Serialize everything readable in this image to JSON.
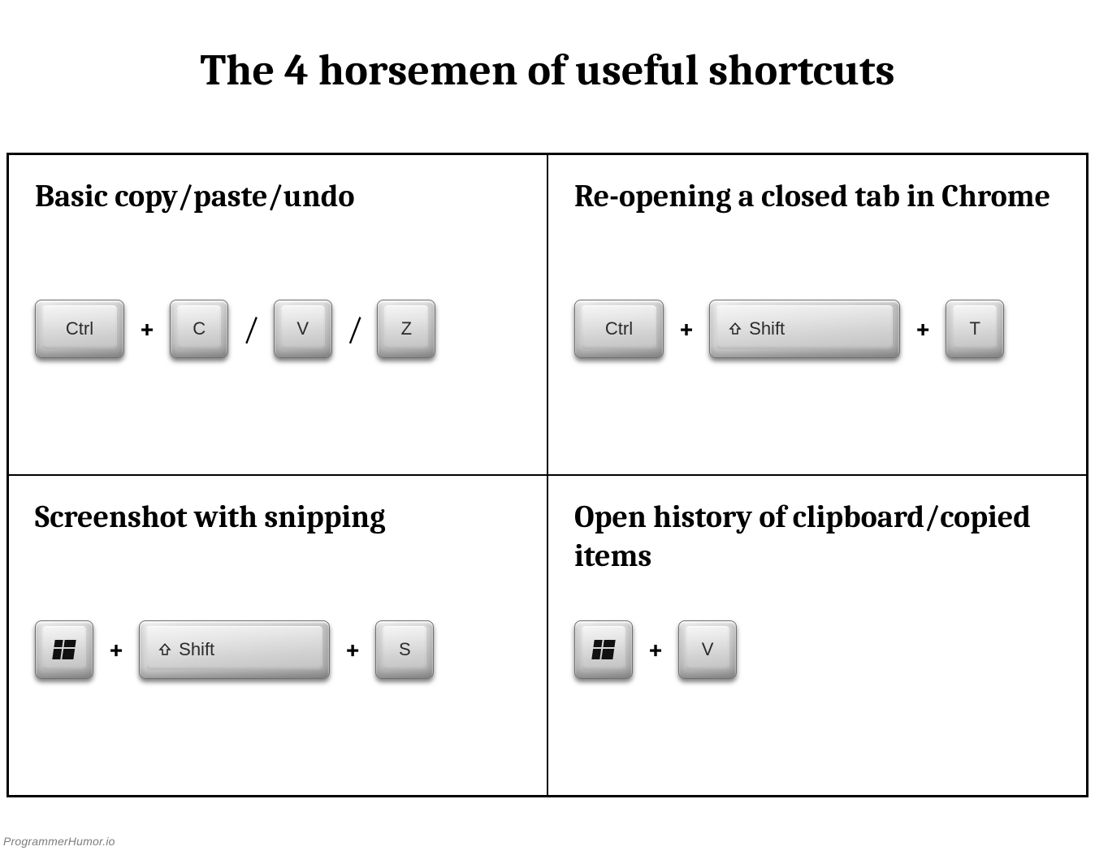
{
  "title": "The 4 horsemen of useful shortcuts",
  "watermark": "ProgrammerHumor.io",
  "sep": {
    "plus": "+",
    "slash": "/"
  },
  "cells": [
    {
      "title": "Basic copy/paste/undo",
      "keys": {
        "ctrl": "Ctrl",
        "c": "C",
        "v": "V",
        "z": "Z"
      }
    },
    {
      "title": "Re-opening a closed tab in Chrome",
      "keys": {
        "ctrl": "Ctrl",
        "shift": "Shift",
        "t": "T"
      }
    },
    {
      "title": "Screenshot with snipping",
      "keys": {
        "win": "Windows",
        "shift": "Shift",
        "s": "S"
      }
    },
    {
      "title": "Open history of clipboard/copied items",
      "keys": {
        "win": "Windows",
        "v": "V"
      }
    }
  ]
}
